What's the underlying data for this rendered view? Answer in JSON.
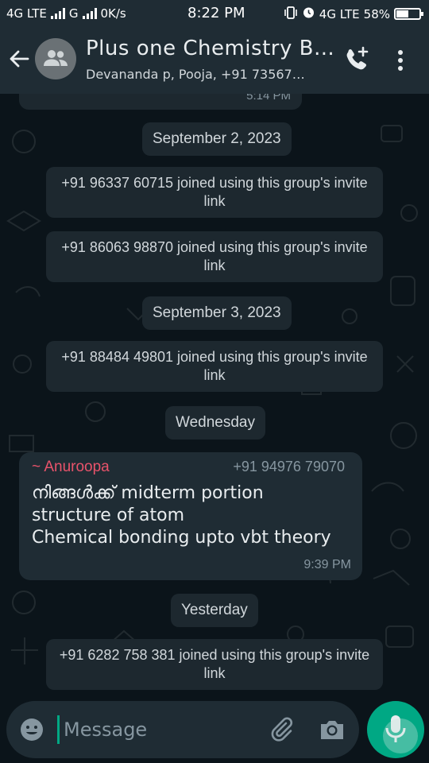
{
  "status_bar": {
    "network1": "4G LTE",
    "network2": "G",
    "speed": "0K/s",
    "time": "8:22 PM",
    "network3": "4G LTE",
    "battery": "58%"
  },
  "header": {
    "title": "Plus one Chemistry B…",
    "subtitle": "Devananda p, Pooja, +91 73567…"
  },
  "chat": {
    "top_stub_time": "5:14 PM",
    "items": [
      {
        "kind": "date",
        "text": "September 2, 2023"
      },
      {
        "kind": "system",
        "text": "+91 96337 60715 joined using this group's invite link"
      },
      {
        "kind": "system",
        "text": "+91 86063 98870 joined using this group's invite link"
      },
      {
        "kind": "date",
        "text": "September 3, 2023"
      },
      {
        "kind": "system",
        "text": "+91 88484 49801 joined using this group's invite link"
      },
      {
        "kind": "date",
        "text": "Wednesday"
      },
      {
        "kind": "date",
        "text": "Yesterday"
      },
      {
        "kind": "system",
        "text": "+91 6282 758 381 joined using this group's invite link"
      }
    ],
    "message": {
      "sender": "~ Anuroopa",
      "phone": "+91 94976 79070",
      "lines": [
        "നിങ്ങൾക്ക്  midterm portion",
        "structure of atom",
        "Chemical bonding upto vbt theory"
      ],
      "time": "9:39 PM"
    }
  },
  "composer": {
    "placeholder": "Message"
  },
  "colors": {
    "accent": "#00a884",
    "sender_name": "#e9536b",
    "bubble": "#1d282f",
    "background": "#0b141a"
  }
}
